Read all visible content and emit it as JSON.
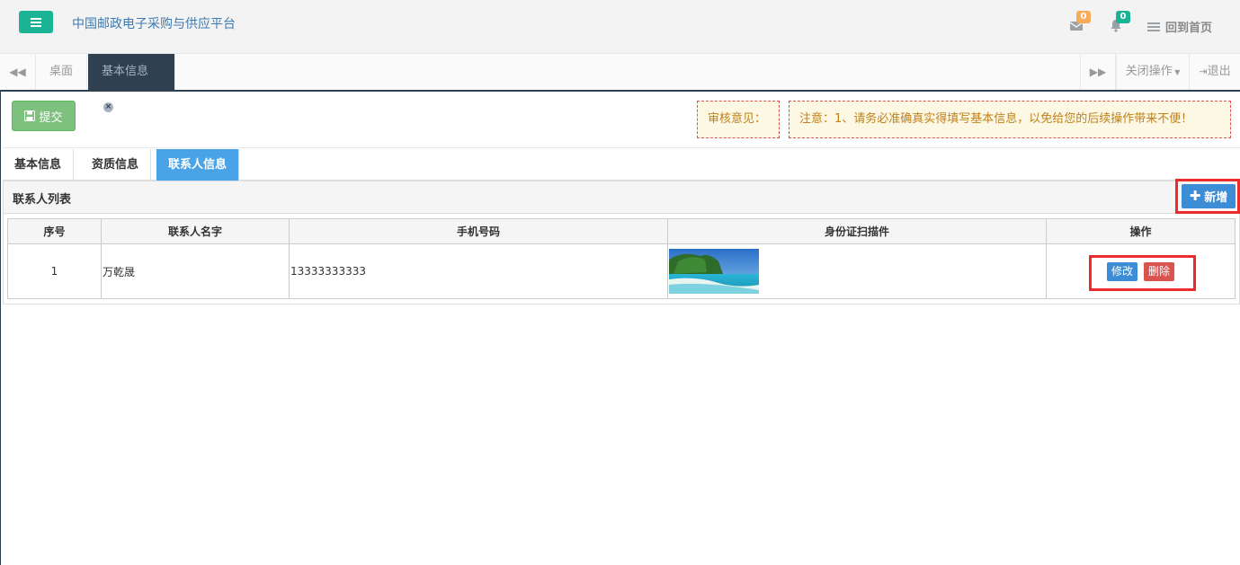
{
  "header": {
    "app_title": "中国邮政电子采购与供应平台",
    "mail_count": "0",
    "bell_count": "0",
    "home_label": "回到首页"
  },
  "tabbar": {
    "tabs": [
      {
        "label": "桌面",
        "active": false
      },
      {
        "label": "基本信息",
        "active": true
      }
    ],
    "close_ops_label": "关闭操作",
    "logout_label": "退出"
  },
  "toolbar": {
    "submit_label": "提交",
    "review_label": "审核意见：",
    "notice_text": "注意：1、请务必准确真实得填写基本信息，以免给您的后续操作带来不便！"
  },
  "info_tabs": [
    {
      "label": "基本信息",
      "active": false
    },
    {
      "label": "资质信息",
      "active": false
    },
    {
      "label": "联系人信息",
      "active": true
    }
  ],
  "panel": {
    "title": "联系人列表",
    "add_label": "新增"
  },
  "table": {
    "columns": [
      "序号",
      "联系人名字",
      "手机号码",
      "身份证扫描件",
      "操作"
    ],
    "rows": [
      {
        "index": "1",
        "name": "万乾晟",
        "phone": "13333333333",
        "edit_label": "修改",
        "delete_label": "删除"
      }
    ]
  },
  "colors": {
    "accent": "#1ab394",
    "nav_dark": "#2f4050",
    "primary": "#3c8dd6",
    "danger": "#d9534f",
    "highlight": "#ec2b2b"
  }
}
